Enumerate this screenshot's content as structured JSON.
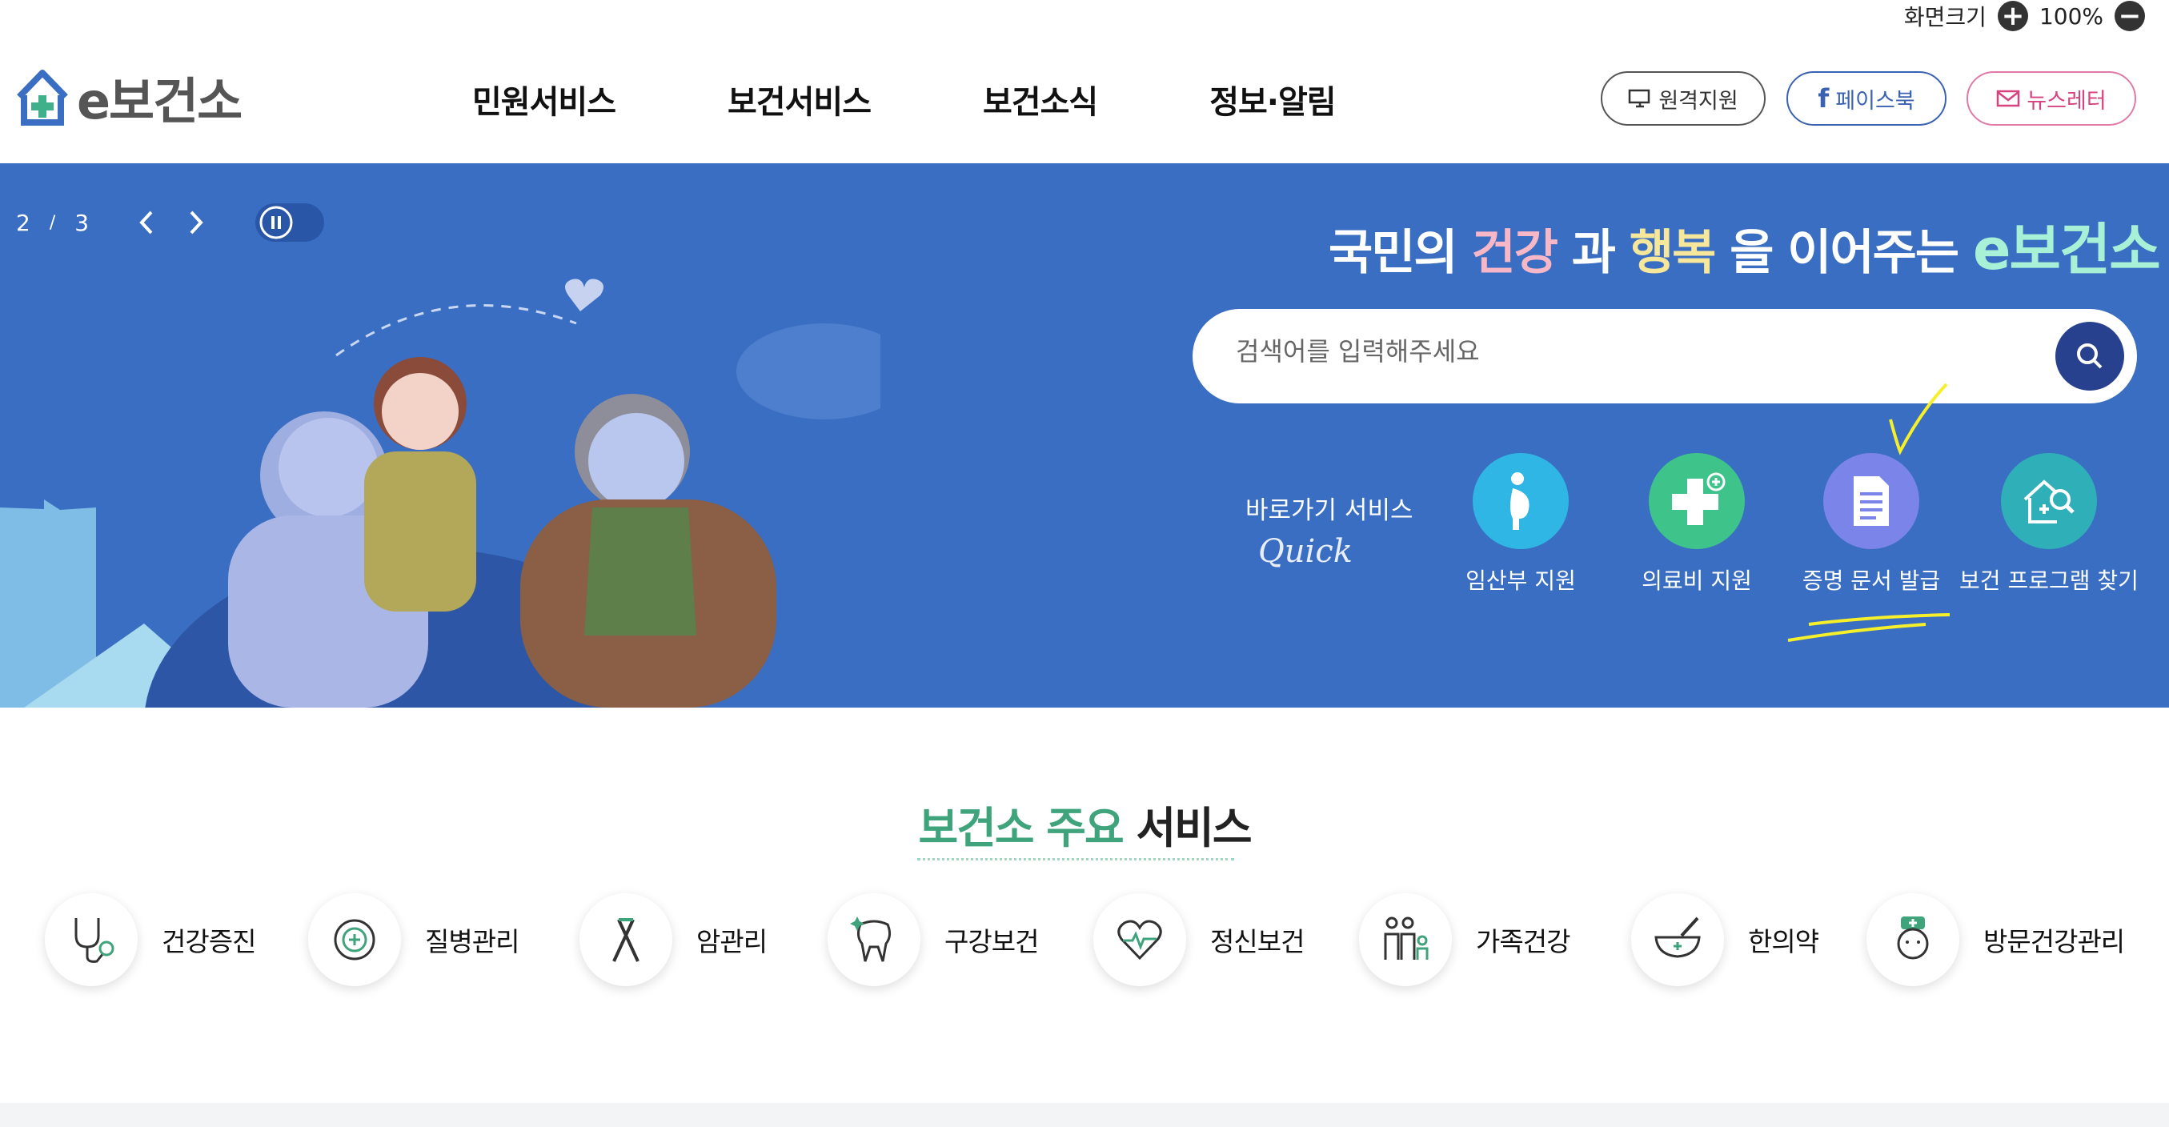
{
  "topbar": {
    "zoom_label": "화면크기",
    "zoom_plus": "+",
    "zoom_value": "100%",
    "zoom_minus": "−"
  },
  "logo": {
    "text": "e보건소"
  },
  "gnb": {
    "items": [
      "민원서비스",
      "보건서비스",
      "보건소식",
      "정보·알림"
    ]
  },
  "header_buttons": {
    "remote": "원격지원",
    "facebook": "페이스북",
    "newsletter": "뉴스레터"
  },
  "hero": {
    "pager_current": "2",
    "pager_sep": "/",
    "pager_total": "3",
    "slogan": {
      "p1": "국민의",
      "p2": "건강",
      "p3": "과",
      "p4": "행복",
      "p5": "을 이어주는",
      "p6": "e보건소"
    },
    "search": {
      "placeholder": "검색어를 입력해주세요"
    },
    "quick_label": "바로가기 서비스",
    "quick_sub": "Quick",
    "quick_items": [
      "임산부 지원",
      "의료비 지원",
      "증명 문서 발급",
      "보건 프로그램 찾기"
    ]
  },
  "services": {
    "title_accent": "보건소 주요",
    "title_rest": "서비스",
    "items": [
      "건강증진",
      "질병관리",
      "암관리",
      "구강보건",
      "정신보건",
      "가족건강",
      "한의약",
      "방문건강관리"
    ]
  },
  "colors": {
    "hero_bg": "#3a6ec2",
    "accent_green": "#3fa37c",
    "search_btn": "#27418f",
    "quick_pink": "#2fb6e4",
    "quick_green": "#3ec38b",
    "quick_purple": "#7b84e8",
    "quick_teal": "#2fb0b8"
  }
}
